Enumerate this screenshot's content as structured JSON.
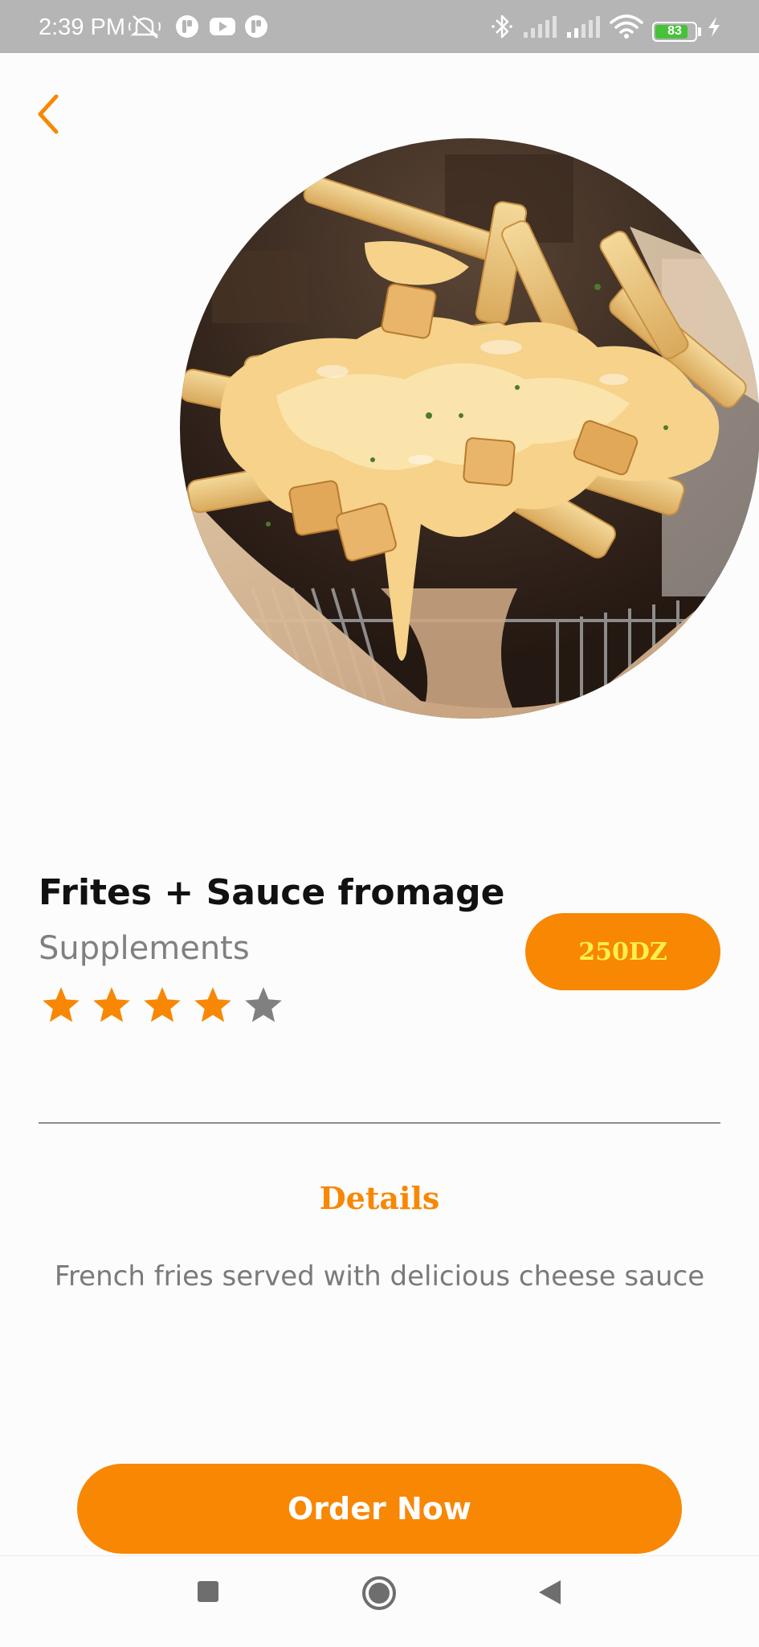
{
  "status_bar": {
    "time": "2:39 PM",
    "battery_percent": "83",
    "battery_level": 0.83,
    "icons": [
      "mute-icon",
      "app-icon",
      "youtube-icon",
      "app-icon",
      "bluetooth-icon",
      "signal-icon",
      "signal-icon",
      "wifi-icon",
      "battery-icon",
      "charging-icon"
    ]
  },
  "product": {
    "name": "Frites + Sauce fromage",
    "category": "Supplements",
    "price": "250DZ",
    "rating": 4,
    "rating_max": 5
  },
  "details": {
    "heading": "Details",
    "description": "French fries served with delicious cheese sauce"
  },
  "actions": {
    "order_label": "Order Now"
  },
  "nav_icons": [
    "recents-icon",
    "home-icon",
    "back-icon"
  ],
  "colors": {
    "accent": "#f88704",
    "price_text": "#fff04a",
    "star_active": "#f88704",
    "star_inactive": "#808080",
    "status_bar": "#b5b5b5"
  }
}
